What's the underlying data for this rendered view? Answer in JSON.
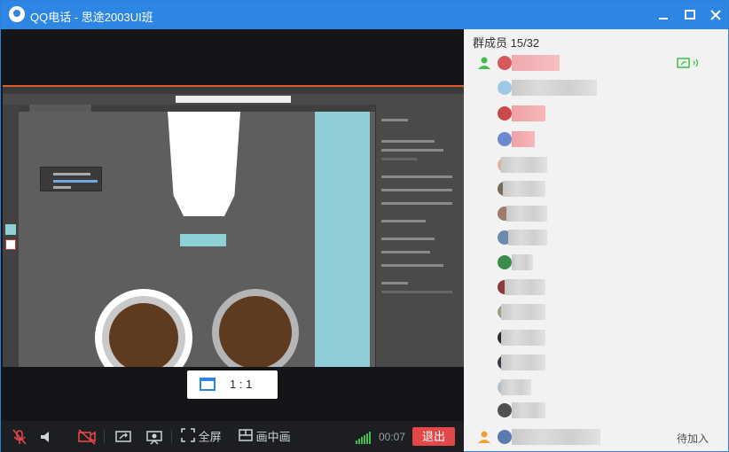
{
  "window": {
    "title": "QQ电话 - 思途2003UI班",
    "controls": [
      "minimize-icon",
      "maximize-icon",
      "close-icon"
    ]
  },
  "video": {
    "ratio_label": "1 : 1"
  },
  "toolbar": {
    "fullscreen_label": "全屏",
    "pip_label": "画中画",
    "timer": "00:07",
    "exit_label": "退出",
    "icons": [
      "mic-muted-icon",
      "speaker-icon",
      "camera-off-icon",
      "screen-share-icon",
      "presenter-icon",
      "fullscreen-icon",
      "picture-in-picture-icon",
      "signal-icon"
    ],
    "colors": {
      "exit": "#e24848",
      "signal": "#3fbf4a"
    }
  },
  "members": {
    "header": "群成员 15/32",
    "pending_label": "待加入",
    "items": [
      {
        "icon": "user-icon",
        "avatar": "#d65a5a"
      },
      {
        "avatar": "#9ec9e6"
      },
      {
        "avatar": "#c94a4a"
      },
      {
        "avatar": "#6a8ad0"
      },
      {
        "avatar": "#e0b0a0"
      },
      {
        "avatar": "#7a6a5a"
      },
      {
        "avatar": "#a07a6a"
      },
      {
        "avatar": "#6a8ab0"
      },
      {
        "avatar": "#3a8a4a"
      },
      {
        "avatar": "#8a3a3a"
      },
      {
        "avatar": "#a0a080"
      },
      {
        "avatar": "#2a2a2a"
      },
      {
        "avatar": "#3a3a4a"
      },
      {
        "avatar": "#b0c0d0"
      },
      {
        "avatar": "#505050"
      },
      {
        "icon": "user-pending-icon",
        "avatar": "#5a7ab0"
      }
    ],
    "speaking_icon": "screen-share-speaking-icon",
    "colors": {
      "speaking": "#3fbf4a"
    }
  }
}
